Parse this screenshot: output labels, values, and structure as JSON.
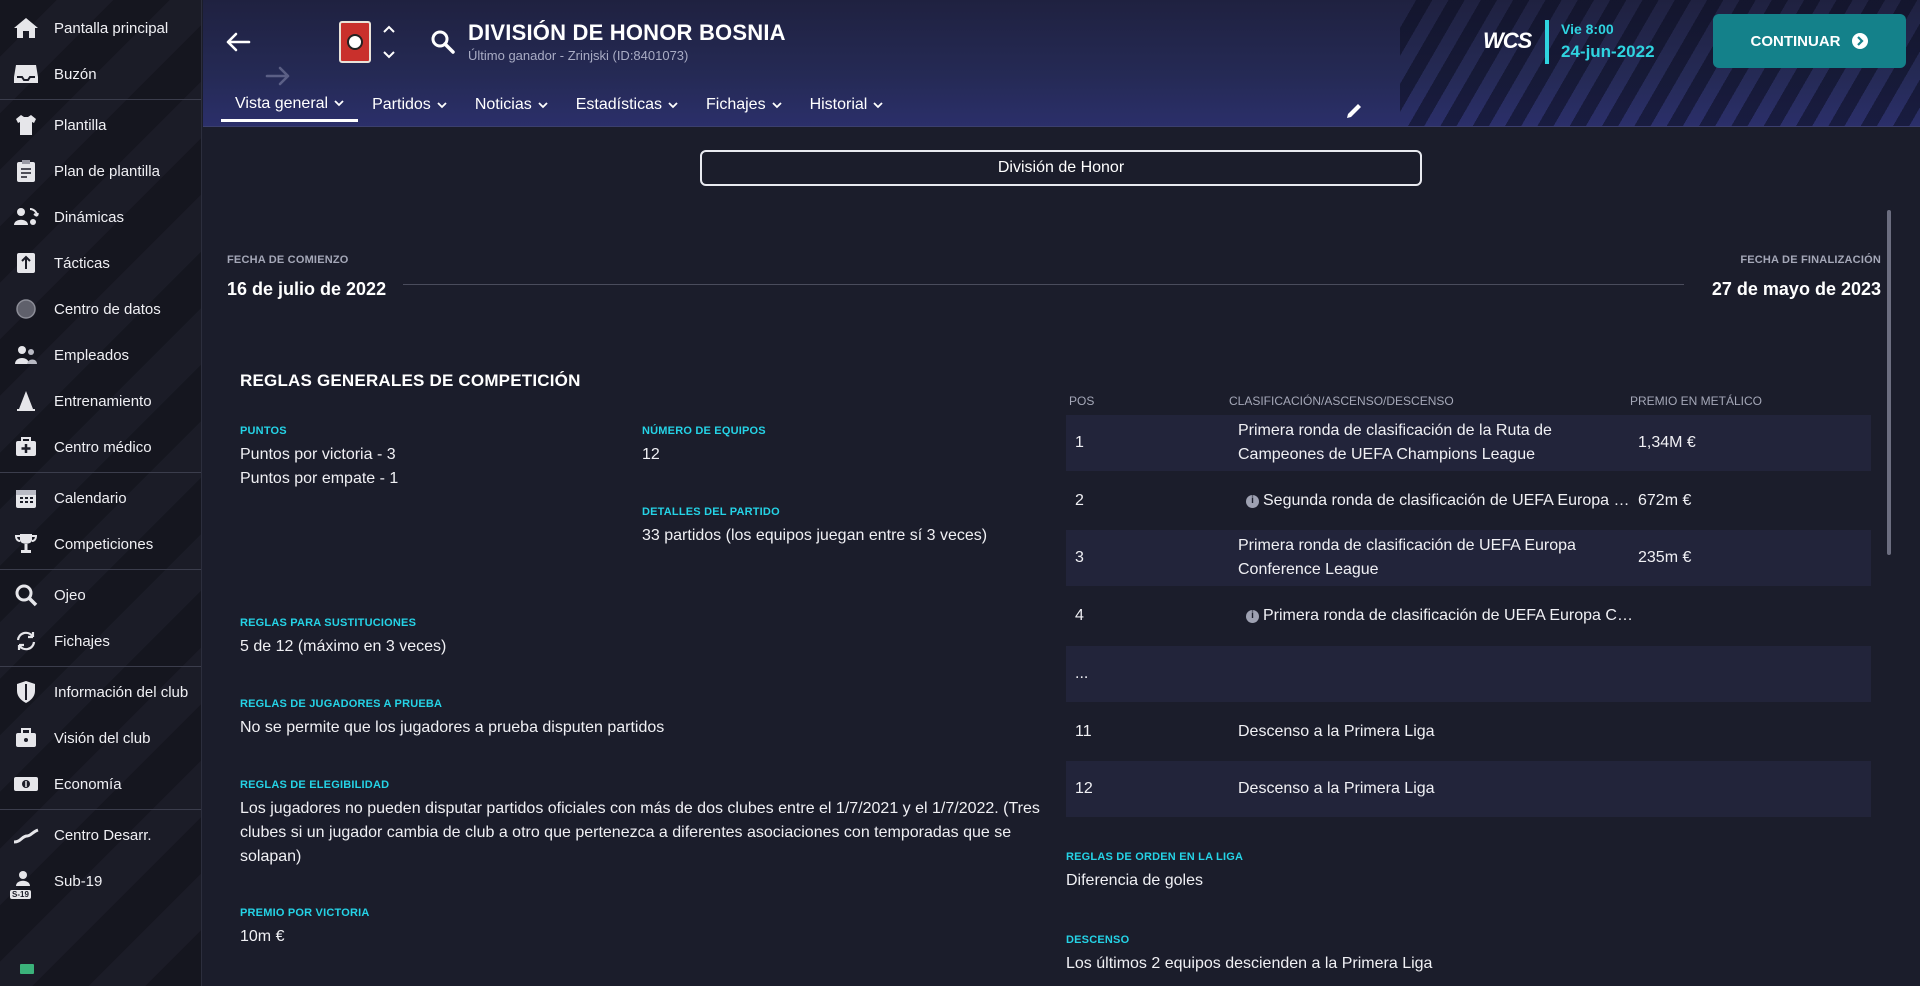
{
  "sidebar": {
    "items": [
      {
        "label": "Pantalla principal",
        "icon": "home-icon"
      },
      {
        "label": "Buzón",
        "icon": "inbox-icon"
      },
      {
        "label": "Plantilla",
        "icon": "shirt-icon"
      },
      {
        "label": "Plan de plantilla",
        "icon": "clipboard-icon"
      },
      {
        "label": "Dinámicas",
        "icon": "people-arrows-icon"
      },
      {
        "label": "Tácticas",
        "icon": "tactics-board-icon"
      },
      {
        "label": "Centro de datos",
        "icon": "data-ball-icon"
      },
      {
        "label": "Empleados",
        "icon": "staff-icon"
      },
      {
        "label": "Entrenamiento",
        "icon": "cone-icon"
      },
      {
        "label": "Centro médico",
        "icon": "medical-kit-icon"
      },
      {
        "label": "Calendario",
        "icon": "calendar-icon"
      },
      {
        "label": "Competiciones",
        "icon": "trophy-icon"
      },
      {
        "label": "Ojeo",
        "icon": "magnifier-icon"
      },
      {
        "label": "Fichajes",
        "icon": "transfer-arrows-icon"
      },
      {
        "label": "Información del club",
        "icon": "shield-icon"
      },
      {
        "label": "Visión del club",
        "icon": "briefcase-icon"
      },
      {
        "label": "Economía",
        "icon": "money-icon"
      },
      {
        "label": "Centro Desarr.",
        "icon": "growth-chart-icon"
      },
      {
        "label": "Sub-19",
        "icon": "u19-icon"
      }
    ],
    "u19_badge": "S-19"
  },
  "header": {
    "title": "DIVISIÓN DE HONOR BOSNIA",
    "subtitle": "Último ganador - Zrinjski (ID:8401073)",
    "brand": "WCS",
    "day_time": "Vie 8:00",
    "date": "24-jun-2022",
    "continue_label": "CONTINUAR",
    "tabs": [
      {
        "label": "Vista general",
        "active": true
      },
      {
        "label": "Partidos",
        "active": false
      },
      {
        "label": "Noticias",
        "active": false
      },
      {
        "label": "Estadísticas",
        "active": false
      },
      {
        "label": "Fichajes",
        "active": false
      },
      {
        "label": "Historial",
        "active": false
      }
    ]
  },
  "main": {
    "division_select": "División de Honor",
    "start_label": "FECHA DE COMIENZO",
    "start_value": "16 de julio de 2022",
    "end_label": "FECHA DE FINALIZACIÓN",
    "end_value": "27 de mayo de 2023",
    "rules_title": "REGLAS GENERALES DE COMPETICIÓN",
    "points_label": "PUNTOS",
    "points_win": "Puntos por victoria - 3",
    "points_draw": "Puntos por empate - 1",
    "teams_label": "NÚMERO DE EQUIPOS",
    "teams_value": "12",
    "match_label": "DETALLES DEL PARTIDO",
    "match_value": "33 partidos (los equipos juegan entre sí 3 veces)",
    "subs_label": "REGLAS PARA SUSTITUCIONES",
    "subs_value": "5 de 12 (máximo en 3 veces)",
    "trial_label": "REGLAS DE JUGADORES A PRUEBA",
    "trial_value": "No se permite que los jugadores a prueba disputen partidos",
    "elig_label": "REGLAS DE ELEGIBILIDAD",
    "elig_value": "Los jugadores no pueden disputar partidos oficiales con más de dos clubes entre el 1/7/2021 y el 1/7/2022. (Tres clubes si un jugador cambia de club a otro que pertenezca a diferentes asociaciones con temporadas que se solapan)",
    "win_prize_label": "PREMIO POR VICTORIA",
    "win_prize_value": "10m €",
    "table": {
      "headers": {
        "pos": "POS",
        "qual": "CLASIFICACIÓN/ASCENSO/DESCENSO",
        "prize": "PREMIO EN METÁLICO"
      },
      "rows": [
        {
          "pos": "1",
          "qual": "Primera ronda de clasificación de la Ruta de Campeones de UEFA Champions League",
          "prize": "1,34M €"
        },
        {
          "pos": "2",
          "qual": "Segunda ronda de clasificación de UEFA Europa League",
          "prize": "672m €"
        },
        {
          "pos": "3",
          "qual": "Primera ronda de clasificación de UEFA Europa Conference League",
          "prize": "235m €"
        },
        {
          "pos": "4",
          "qual": "Primera ronda de clasificación de UEFA Europa Conference League",
          "prize": ""
        },
        {
          "pos": "...",
          "qual": "",
          "prize": ""
        },
        {
          "pos": "11",
          "qual": "Descenso a la Primera Liga",
          "prize": ""
        },
        {
          "pos": "12",
          "qual": "Descenso a la Primera Liga",
          "prize": ""
        }
      ]
    },
    "order_label": "REGLAS DE ORDEN EN LA LIGA",
    "order_value": "Diferencia de goles",
    "relegation_label": "DESCENSO",
    "relegation_value": "Los últimos 2 equipos descienden a la Primera Liga"
  }
}
